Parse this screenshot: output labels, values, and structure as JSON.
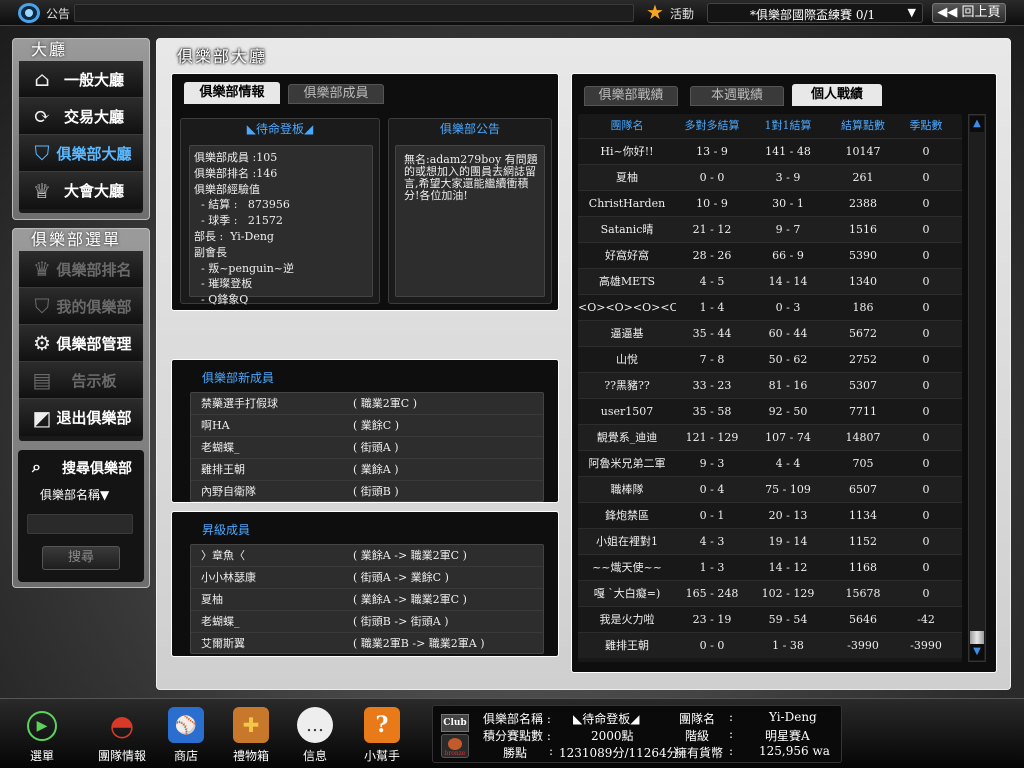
{
  "topbar": {
    "notice_label": "公告",
    "activity_label": "活動",
    "activity_value": "*俱樂部國際盃練賽 0/1",
    "back_label": "◀◀ 回上頁"
  },
  "sidebar": {
    "hall_title": "大廳",
    "hall_items": [
      {
        "label": "一般大廳"
      },
      {
        "label": "交易大廳"
      },
      {
        "label": "俱樂部大廳"
      },
      {
        "label": "大會大廳"
      }
    ],
    "club_menu_title": "俱樂部選單",
    "club_items": [
      {
        "label": "俱樂部排名"
      },
      {
        "label": "我的俱樂部"
      },
      {
        "label": "俱樂部管理"
      },
      {
        "label": "告示板"
      },
      {
        "label": "退出俱樂部"
      }
    ],
    "search": {
      "title": "搜尋俱樂部",
      "select_value": "俱樂部名稱▼",
      "button": "搜尋"
    }
  },
  "main": {
    "title": "俱樂部大廳",
    "left_tabs": [
      "俱樂部情報",
      "俱樂部成員"
    ],
    "club_info": {
      "head": "◣待命登板◢",
      "lines": [
        "俱樂部成員 :105",
        "俱樂部排名 :146",
        "俱樂部經驗值",
        "  - 結算 :   873956",
        "  - 球季 :   21572",
        "部長 :  Yi-Deng",
        "副會長",
        "  - 叛~penguin~逆",
        "  - 璀璨登板",
        "  - Q鋒象Q"
      ]
    },
    "announcement": {
      "head": "俱樂部公告",
      "text": "無名:adam279boy 有問題的或想加入的團員去網誌留言,希望大家還能繼續衝積分!各位加油!"
    },
    "new_members": {
      "head": "俱樂部新成員",
      "rows": [
        {
          "name": "禁藥選手打假球",
          "level": "( 職業2軍C )"
        },
        {
          "name": "啊HA",
          "level": "( 業餘C )"
        },
        {
          "name": "老蝴蝶_",
          "level": "( 街頭A )"
        },
        {
          "name": "雞排王朝",
          "level": "( 業餘A )"
        },
        {
          "name": "內野自衛隊",
          "level": "( 街頭B )"
        }
      ]
    },
    "promoted": {
      "head": "昇級成員",
      "rows": [
        {
          "name": "〉章魚〈",
          "level": "( 業餘A -> 職業2軍C )"
        },
        {
          "name": "小小林瑟康",
          "level": "( 街頭A -> 業餘C )"
        },
        {
          "name": "夏柚",
          "level": "( 業餘A -> 職業2軍C )"
        },
        {
          "name": "老蝴蝶_",
          "level": "( 街頭B -> 街頭A )"
        },
        {
          "name": "艾爾斯翼",
          "level": "( 職業2軍B -> 職業2軍A )"
        }
      ]
    },
    "right_tabs": [
      "俱樂部戰績",
      "本週戰績",
      "個人戰績"
    ],
    "stats": {
      "headers": [
        "團隊名",
        "多對多結算",
        "1對1結算",
        "結算點數",
        "季點數"
      ],
      "rows": [
        [
          "Hi~你好!!",
          "13 - 9",
          "141 - 48",
          "10147",
          "0"
        ],
        [
          "夏柚",
          "0 - 0",
          "3 - 9",
          "261",
          "0"
        ],
        [
          "ChristHarden",
          "10 - 9",
          "30 - 1",
          "2388",
          "0"
        ],
        [
          "Satanic晴",
          "21 - 12",
          "9 - 7",
          "1516",
          "0"
        ],
        [
          "好窩好窩",
          "28 - 26",
          "66 - 9",
          "5390",
          "0"
        ],
        [
          "高雄METS",
          "4 - 5",
          "14 - 14",
          "1340",
          "0"
        ],
        [
          "<O><O><O><O><O>",
          "1 - 4",
          "0 - 3",
          "186",
          "0"
        ],
        [
          "逼逼基",
          "35 - 44",
          "60 - 44",
          "5672",
          "0"
        ],
        [
          "山悅",
          "7 - 8",
          "50 - 62",
          "2752",
          "0"
        ],
        [
          "??黑豬??",
          "33 - 23",
          "81 - 16",
          "5307",
          "0"
        ],
        [
          "user1507",
          "35 - 58",
          "92 - 50",
          "7711",
          "0"
        ],
        [
          "靚覺系_迪迪",
          "121 - 129",
          "107 - 74",
          "14807",
          "0"
        ],
        [
          "阿魯米兄弟二軍",
          "9 - 3",
          "4 - 4",
          "705",
          "0"
        ],
        [
          "職棒隊",
          "0 - 4",
          "75 - 109",
          "6507",
          "0"
        ],
        [
          "鋒炮禁區",
          "0 - 1",
          "20 - 13",
          "1134",
          "0"
        ],
        [
          "小姐在裡對1",
          "4 - 3",
          "19 - 14",
          "1152",
          "0"
        ],
        [
          "~~熾天使~~",
          "1 - 3",
          "14 - 12",
          "1168",
          "0"
        ],
        [
          "嘎 `大白癡=)",
          "165 - 248",
          "102 - 129",
          "15678",
          "0"
        ],
        [
          "我是火力啦",
          "23 - 19",
          "59 - 54",
          "5646",
          "-42"
        ],
        [
          "雞排王朝",
          "0 - 0",
          "1 - 38",
          "-3990",
          "-3990"
        ]
      ]
    }
  },
  "bottombar": {
    "buttons": [
      {
        "label": "選單"
      },
      {
        "label": "團隊情報"
      },
      {
        "label": "商店"
      },
      {
        "label": "禮物箱"
      },
      {
        "label": "信息"
      },
      {
        "label": "小幫手"
      }
    ],
    "club_badge": {
      "top": "Club",
      "bottom": "bronze"
    },
    "status": {
      "club_name_label": "俱樂部名稱 :",
      "club_name_value": "◣待命登板◢",
      "points_label": "積分賽點數 :",
      "points_value": "2000點",
      "win_label": "勝點",
      "win_sep": ":",
      "win_value": "1231089分/11264分",
      "team_label": "團隊名",
      "team_sep": ":",
      "team_value": "Yi-Deng",
      "rank_label": "階級",
      "rank_sep": ":",
      "rank_value": "明星賽A",
      "coin_label": "擁有貨幣",
      "coin_sep": ":",
      "coin_value": "125,956 wa"
    }
  }
}
